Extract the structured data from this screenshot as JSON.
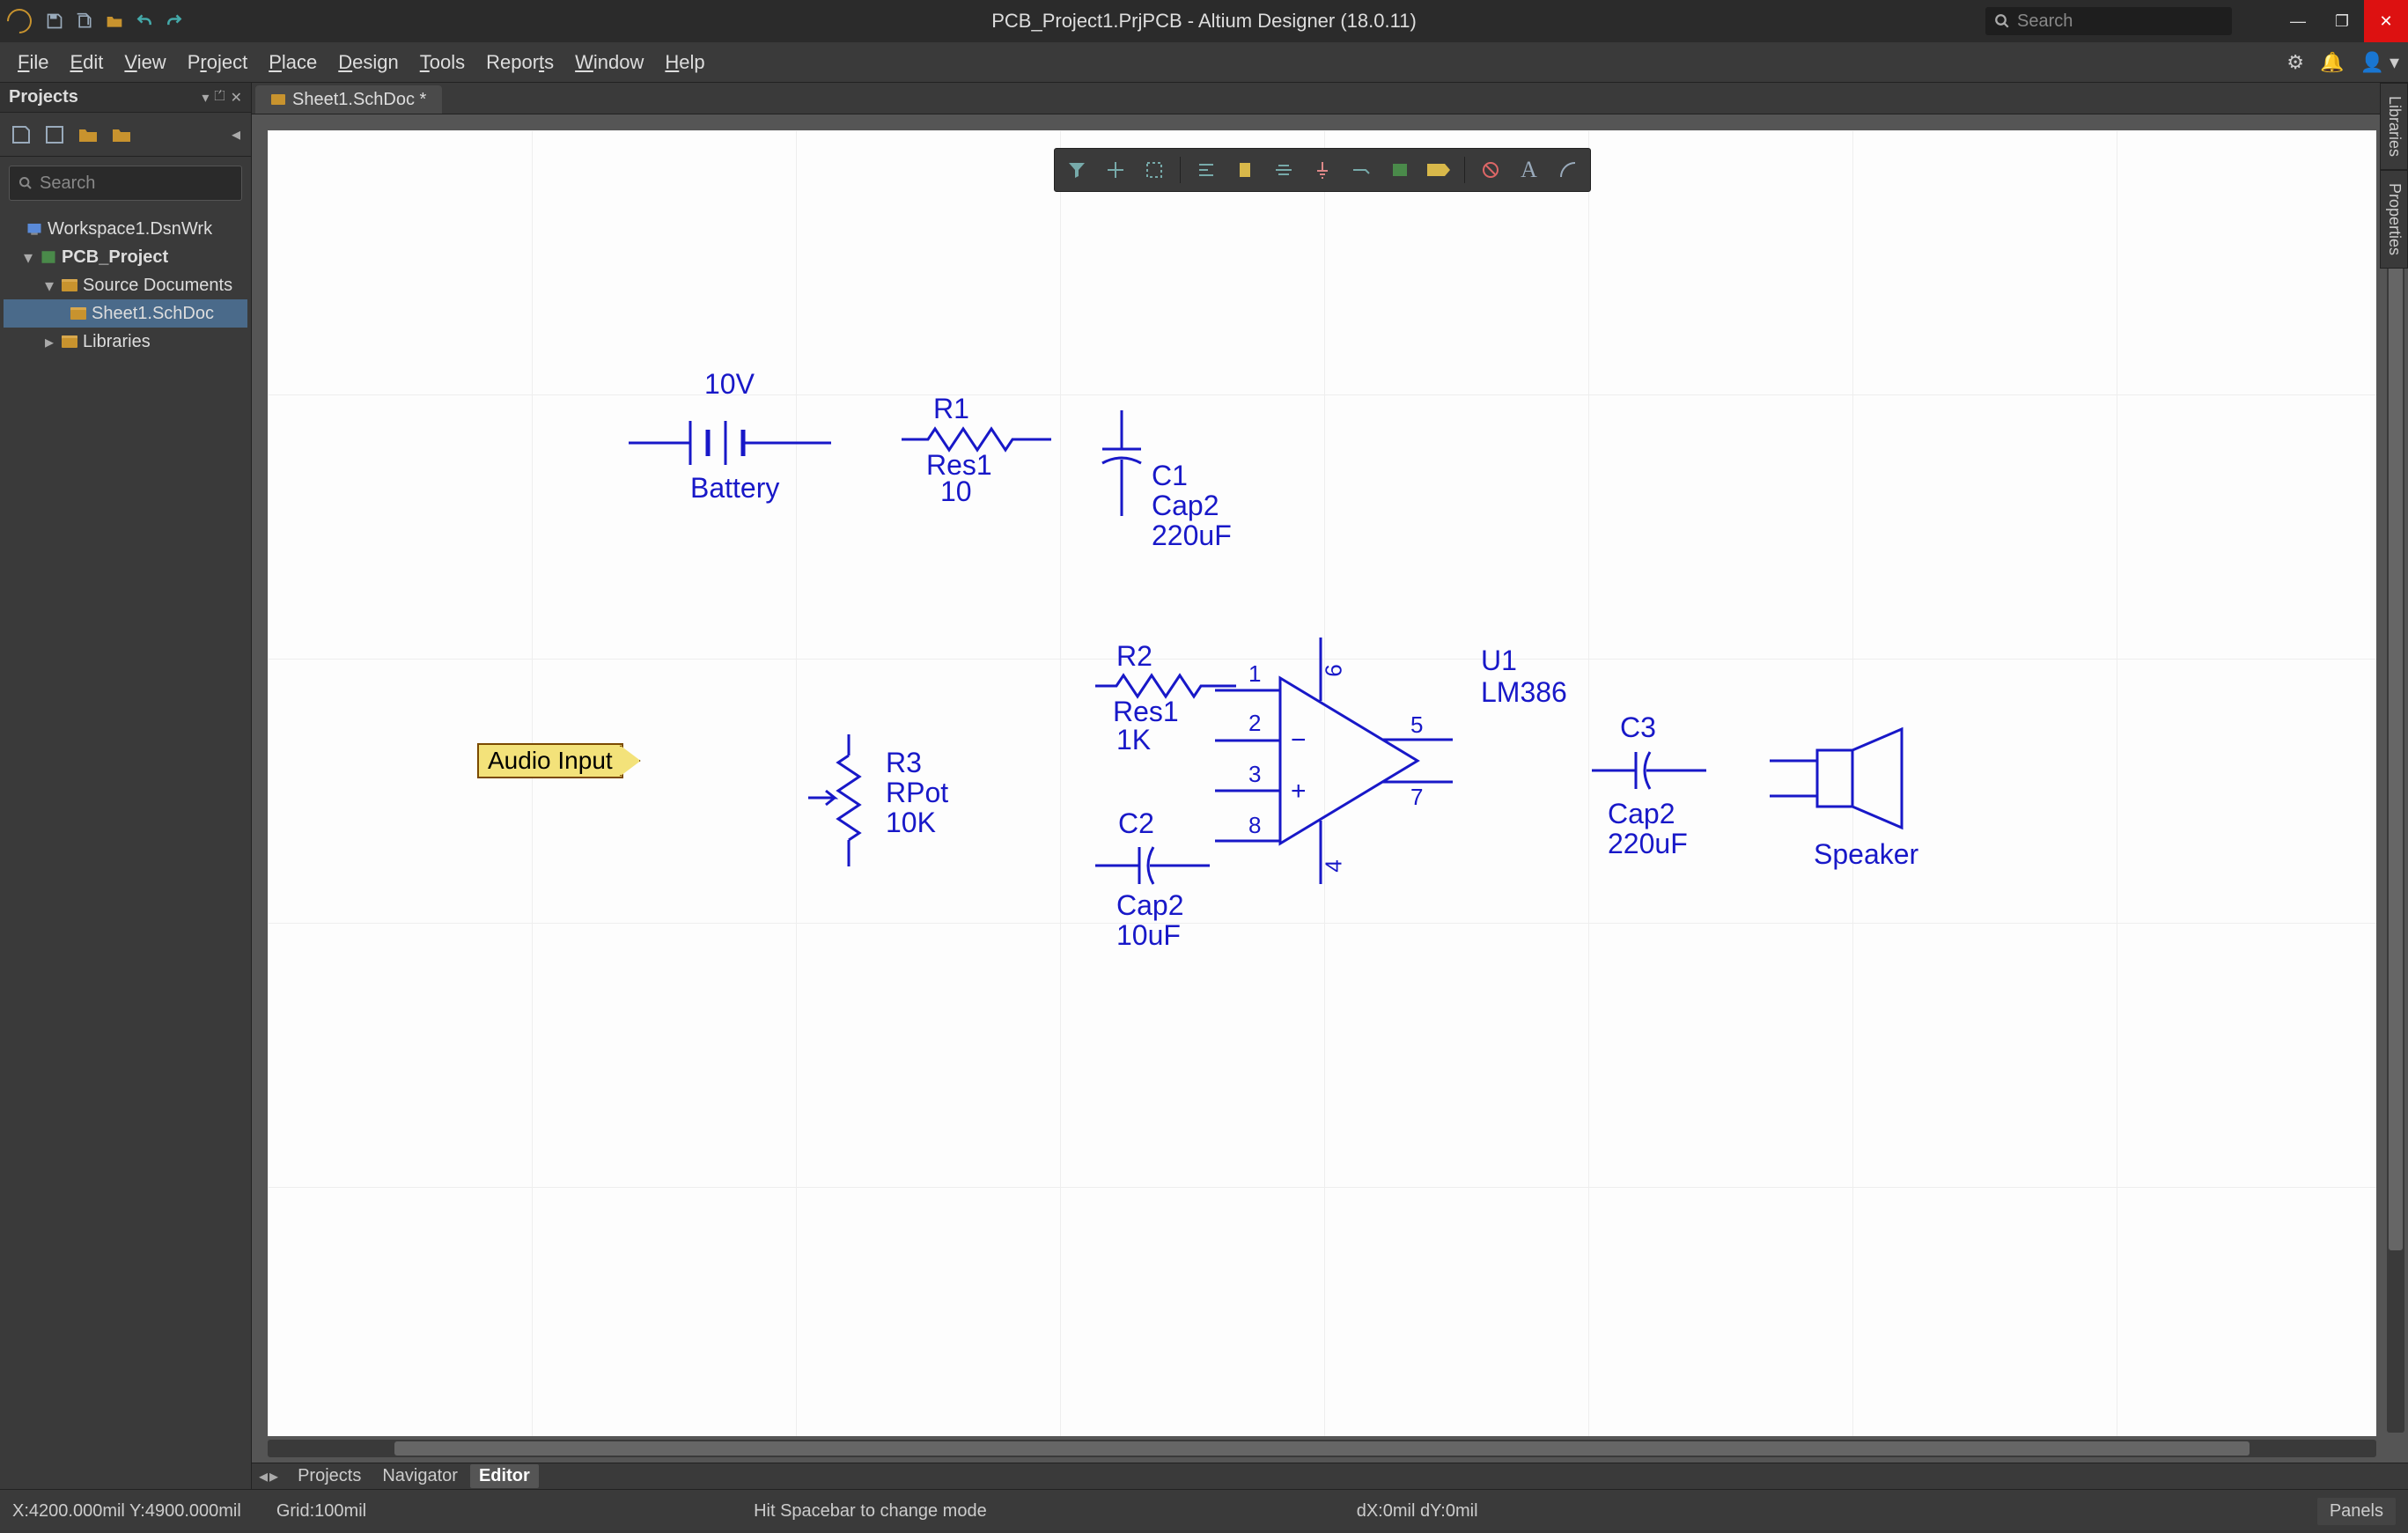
{
  "title": "PCB_Project1.PrjPCB - Altium Designer (18.0.11)",
  "search_placeholder": "Search",
  "menu": [
    "File",
    "Edit",
    "View",
    "Project",
    "Place",
    "Design",
    "Tools",
    "Reports",
    "Window",
    "Help"
  ],
  "projects_panel": {
    "title": "Projects",
    "search_placeholder": "Search",
    "tree": {
      "workspace": "Workspace1.DsnWrk",
      "project": "PCB_Project",
      "source_docs": "Source Documents",
      "sheet": "Sheet1.SchDoc",
      "libraries": "Libraries"
    }
  },
  "open_tab": "Sheet1.SchDoc *",
  "dock_tabs": [
    "Libraries",
    "Properties"
  ],
  "bottom_tabs": [
    "Projects",
    "Navigator",
    "Editor"
  ],
  "active_bottom_tab": "Editor",
  "status": {
    "coords": "X:4200.000mil Y:4900.000mil",
    "grid": "Grid:100mil",
    "hint": "Hit Spacebar to change mode",
    "delta": "dX:0mil dY:0mil",
    "panels": "Panels"
  },
  "schematic": {
    "port": "Audio Input",
    "battery": {
      "designator": "10V",
      "name": "Battery"
    },
    "R1": {
      "designator": "R1",
      "name": "Res1",
      "value": "10"
    },
    "R2": {
      "designator": "R2",
      "name": "Res1",
      "value": "1K"
    },
    "R3": {
      "designator": "R3",
      "name": "RPot",
      "value": "10K"
    },
    "C1": {
      "designator": "C1",
      "name": "Cap2",
      "value": "220uF"
    },
    "C2": {
      "designator": "C2",
      "name": "Cap2",
      "value": "10uF"
    },
    "C3": {
      "designator": "C3",
      "name": "Cap2",
      "value": "220uF"
    },
    "U1": {
      "designator": "U1",
      "name": "LM386",
      "pins": [
        "1",
        "2",
        "3",
        "4",
        "5",
        "6",
        "7",
        "8"
      ]
    },
    "speaker": "Speaker"
  },
  "place_toolbar_icons": [
    "filter",
    "cross-probe",
    "rubber-stamp",
    "align",
    "bus",
    "net-label",
    "power-port",
    "net",
    "part",
    "directive",
    "no-erc",
    "text",
    "arc"
  ]
}
